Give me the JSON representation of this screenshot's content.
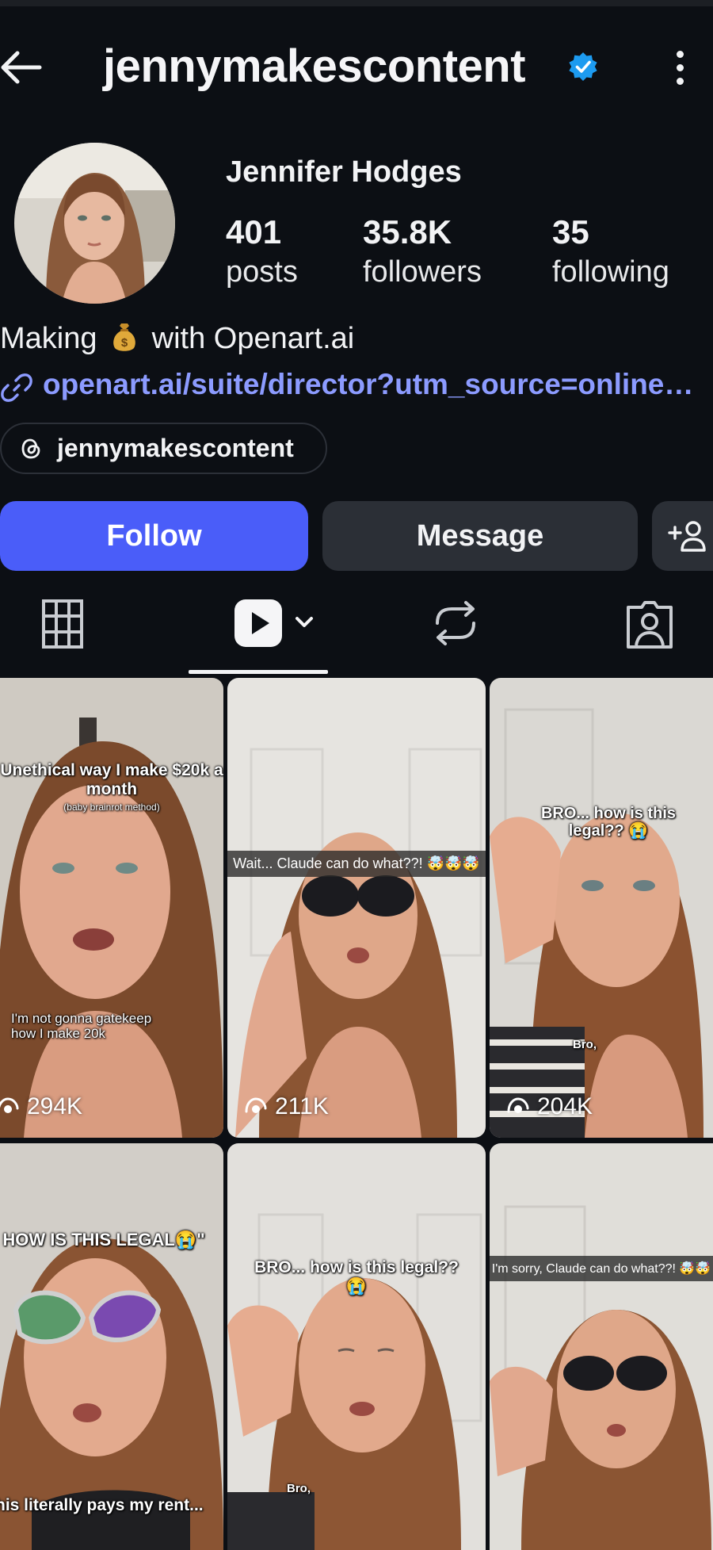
{
  "header": {
    "username": "jennymakescontent",
    "verified": true,
    "back_icon": "arrow-left-icon",
    "menu_icon": "more-vertical-icon"
  },
  "profile": {
    "display_name": "Jennifer Hodges",
    "stats": {
      "posts": {
        "value": "401",
        "label": "posts"
      },
      "followers": {
        "value": "35.8K",
        "label": "followers"
      },
      "following": {
        "value": "35",
        "label": "following"
      }
    },
    "bio": {
      "prefix": "Making",
      "emoji": "money-bag-emoji",
      "suffix": "with Openart.ai"
    },
    "link": "openart.ai/suite/director?utm_source=online…",
    "threads_handle": "jennymakescontent"
  },
  "actions": {
    "follow_label": "Follow",
    "message_label": "Message",
    "add_user_icon": "add-user-icon"
  },
  "tabs": [
    {
      "name": "grid",
      "icon": "grid-icon"
    },
    {
      "name": "reels",
      "icon": "reels-icon",
      "active": true
    },
    {
      "name": "reposts",
      "icon": "repost-icon"
    },
    {
      "name": "tagged",
      "icon": "tagged-icon"
    }
  ],
  "reels": [
    {
      "caption": "Unethical way I make $20k a month",
      "sub": "(baby brainrot method)",
      "caption2": "I'm not gonna gatekeep how I make 20k",
      "views": "294K"
    },
    {
      "banner": "Wait... Claude can do what??! 🤯🤯🤯",
      "views": "211K"
    },
    {
      "caption": "BRO... how is this legal?? 😭",
      "caption2": "Bro,",
      "views": "204K"
    },
    {
      "caption": "HOW IS THIS LEGAL😭\"",
      "caption2": "his literally pays my rent..."
    },
    {
      "caption": "BRO... how is this legal?? 😭",
      "caption2": "Bro,"
    },
    {
      "banner": "I'm sorry, Claude can do what??! 🤯🤯"
    }
  ],
  "colors": {
    "background": "#0c0f14",
    "accent": "#4a5df9",
    "link": "#8c9bff",
    "verified": "#1d9bf0",
    "secondary_button": "#2b2f36"
  }
}
